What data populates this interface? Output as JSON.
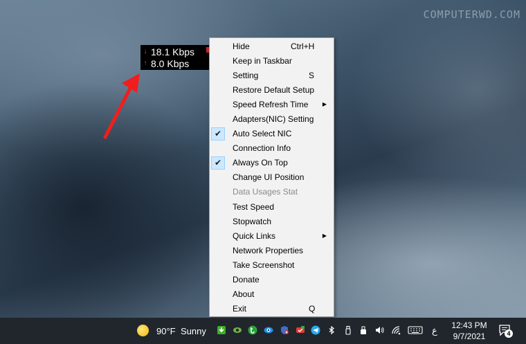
{
  "watermark": "COMPUTERWD.COM",
  "speed_widget": {
    "download": "18.1 Kbps",
    "upload": "8.0 Kbps",
    "download_arrow": "↓",
    "upload_arrow": "↑"
  },
  "context_menu": {
    "items": [
      {
        "label": "Hide",
        "shortcut": "Ctrl+H"
      },
      {
        "label": "Keep in Taskbar"
      },
      {
        "label": "Setting",
        "shortcut": "S"
      },
      {
        "label": "Restore Default Setup"
      },
      {
        "label": "Speed Refresh Time",
        "submenu": "▶"
      },
      {
        "label": "Adapters(NIC) Setting"
      },
      {
        "label": "Auto Select NIC",
        "checked": "✔"
      },
      {
        "label": "Connection Info"
      },
      {
        "label": "Always On Top",
        "checked": "✔"
      },
      {
        "label": "Change UI Position"
      },
      {
        "label": "Data Usages Stat",
        "disabled": true
      },
      {
        "label": "Test Speed"
      },
      {
        "label": "Stopwatch"
      },
      {
        "label": "Quick Links",
        "submenu": "▶"
      },
      {
        "label": "Network Properties"
      },
      {
        "label": "Take Screenshot"
      },
      {
        "label": "Donate"
      },
      {
        "label": "About"
      },
      {
        "label": "Exit",
        "shortcut": "Q"
      }
    ]
  },
  "taskbar": {
    "weather": {
      "temp": "90°F",
      "condition": "Sunny",
      "icon": "sun-icon"
    },
    "language": "ع",
    "time": "12:43 PM",
    "date": "9/7/2021",
    "notification_count": "4",
    "tray_icons": [
      "shield-update-icon",
      "eye-icon",
      "torrent-icon",
      "eye-care-icon",
      "antivirus-icon",
      "vpn-icon",
      "telegram-icon",
      "bluetooth-icon",
      "usb-icon",
      "volume-icon",
      "wifi-icon",
      "keyboard-icon"
    ]
  },
  "colors": {
    "taskbar_bg": "#20262c",
    "menu_bg": "#f2f2f2",
    "check_bg": "#cce8ff",
    "arrow_red": "#ff3b2f",
    "widget_bg": "#000000"
  }
}
